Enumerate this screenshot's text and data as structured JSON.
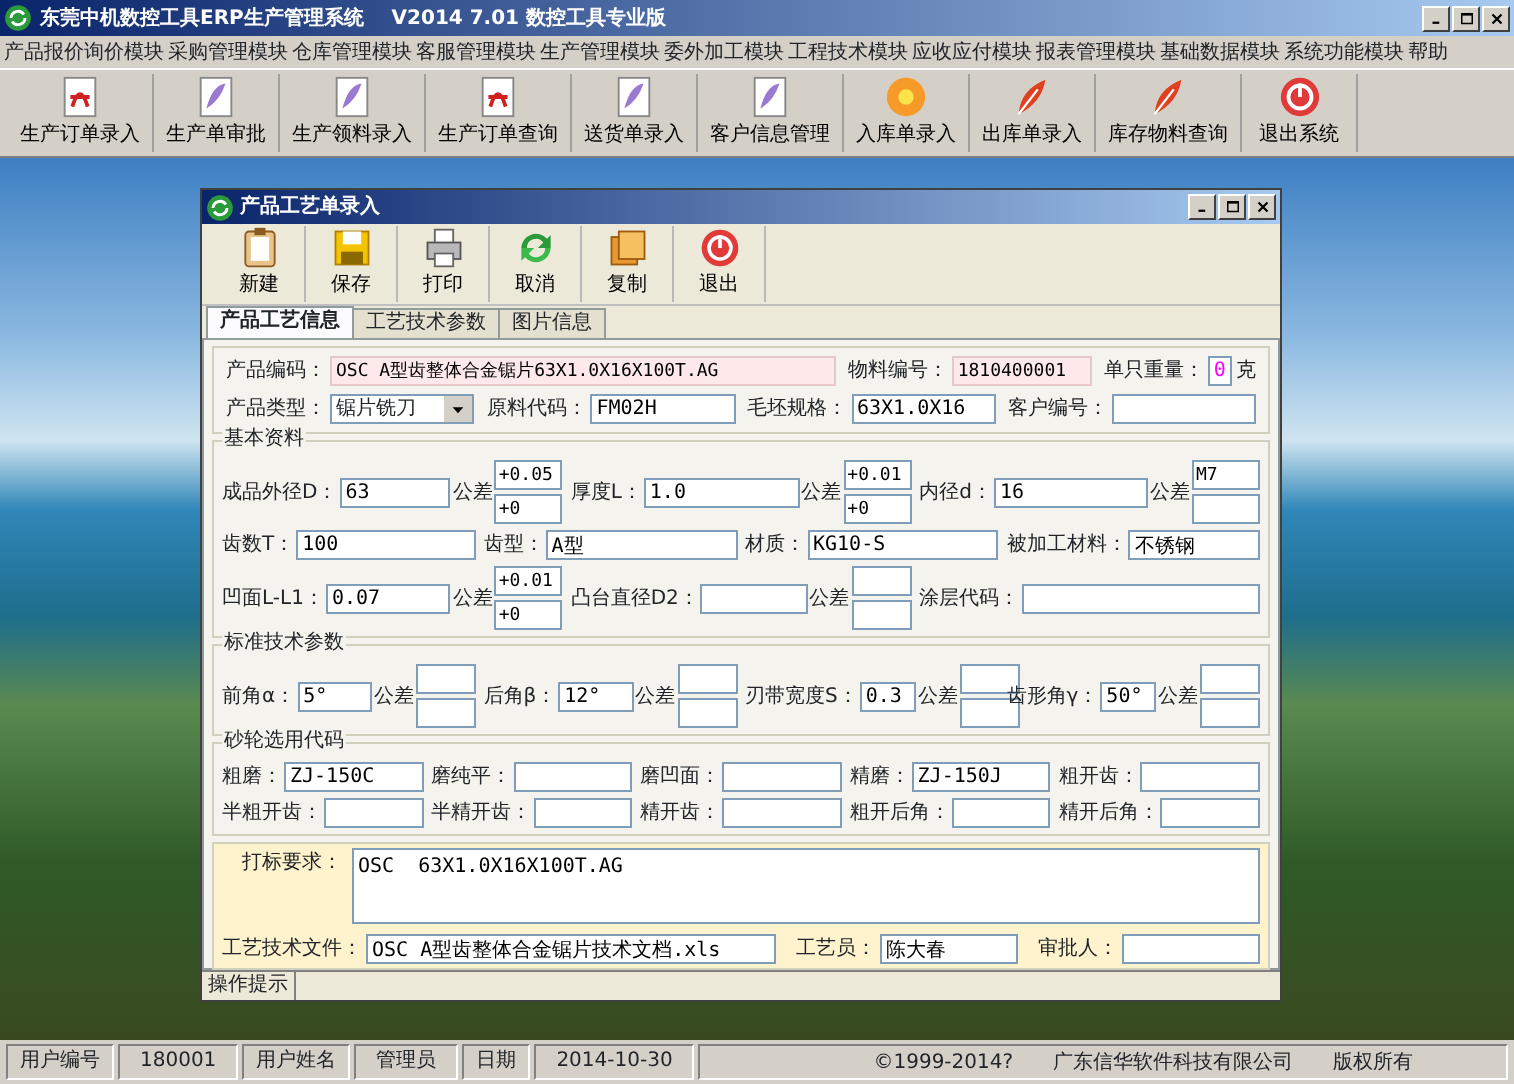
{
  "window": {
    "title": "东莞中机数控工具ERP生产管理系统    V2014 7.01 数控工具专业版"
  },
  "menu": [
    "产品报价询价模块",
    "采购管理模块",
    "仓库管理模块",
    "客服管理模块",
    "生产管理模块",
    "委外加工模块",
    "工程技术模块",
    "应收应付模块",
    "报表管理模块",
    "基础数据模块",
    "系统功能模块",
    "帮助"
  ],
  "toolbar": [
    {
      "label": "生产订单录入",
      "kind": "document"
    },
    {
      "label": "生产单审批",
      "kind": "leaf"
    },
    {
      "label": "生产领料录入",
      "kind": "leaf"
    },
    {
      "label": "生产订单查询",
      "kind": "document"
    },
    {
      "label": "送货单录入",
      "kind": "leaf"
    },
    {
      "label": "客户信息管理",
      "kind": "leaf"
    },
    {
      "label": "入库单录入",
      "kind": "flower"
    },
    {
      "label": "出库单录入",
      "kind": "feather"
    },
    {
      "label": "库存物料查询",
      "kind": "feather"
    },
    {
      "label": "退出系统",
      "kind": "exit"
    }
  ],
  "dialog": {
    "title": "产品工艺单录入",
    "toolbar": [
      {
        "label": "新建",
        "kind": "clipboard"
      },
      {
        "label": "保存",
        "kind": "floppy"
      },
      {
        "label": "打印",
        "kind": "printer"
      },
      {
        "label": "取消",
        "kind": "refresh"
      },
      {
        "label": "复制",
        "kind": "copy"
      },
      {
        "label": "退出",
        "kind": "exit"
      }
    ],
    "tabs": [
      {
        "label": "产品工艺信息",
        "selected": true
      },
      {
        "label": "工艺技术参数",
        "selected": false
      },
      {
        "label": "图片信息",
        "selected": false
      }
    ],
    "header_rows": [
      [
        {
          "label": "产品编码：",
          "value": "OSC A型齿整体合金锯片63X1.0X16X100T.AG",
          "kind": "required"
        },
        {
          "label": "物料编号：",
          "value": "1810400001",
          "kind": "required"
        },
        {
          "label": "单只重量：",
          "value": "0",
          "unit": "克",
          "kind": "number"
        }
      ],
      [
        {
          "label": "产品类型：",
          "value": "锯片铣刀",
          "kind": "select"
        },
        {
          "label": "原料代码：",
          "value": "FM02H",
          "kind": "text"
        },
        {
          "label": "毛坯规格：",
          "value": "63X1.0X16",
          "kind": "text"
        },
        {
          "label": "客户编号：",
          "kind": "text"
        }
      ]
    ],
    "groups": [
      {
        "title": "基本资料",
        "lines": [
          {
            "fields": [
              {
                "label": "成品外径D：",
                "value": "63",
                "tolerance": {
                  "label": "公差",
                  "upper": "+0.05",
                  "lower": "+0"
                }
              },
              {
                "label": "厚度L：",
                "value": "1.0",
                "tolerance": {
                  "label": "公差",
                  "upper": "+0.01",
                  "lower": "+0"
                }
              },
              {
                "label": "内径d：",
                "value": "16",
                "tolerance": {
                  "label": "公差",
                  "upper": "M7"
                }
              }
            ]
          },
          {
            "fields": [
              {
                "label": "齿数T：",
                "value": "100"
              },
              {
                "label": "齿型：",
                "value": "A型"
              },
              {
                "label": "材质：",
                "value": "KG10-S"
              },
              {
                "label": "被加工材料：",
                "value": "不锈钢"
              }
            ]
          },
          {
            "fields": [
              {
                "label": "凹面L-L1：",
                "value": "0.07",
                "tolerance": {
                  "label": "公差",
                  "upper": "+0.01",
                  "lower": "+0"
                }
              },
              {
                "label": "凸台直径D2：",
                "tolerance": {
                  "label": "公差"
                }
              },
              {
                "label": "涂层代码："
              }
            ]
          }
        ]
      },
      {
        "title": "标准技术参数",
        "lines": [
          {
            "fields": [
              {
                "label": "前角α：",
                "value": "5°",
                "tolerance": {
                  "label": "公差"
                }
              },
              {
                "label": "后角β：",
                "value": "12°",
                "tolerance": {
                  "label": "公差"
                }
              },
              {
                "label": "刃带宽度S：",
                "value": "0.3",
                "tolerance": {
                  "label": "公差"
                }
              },
              {
                "label": "齿形角γ：",
                "value": "50°",
                "tolerance": {
                  "label": "公差"
                }
              }
            ]
          }
        ]
      },
      {
        "title": "砂轮选用代码",
        "lines": [
          {
            "fields": [
              {
                "label": "粗磨：",
                "value": "ZJ-150C"
              },
              {
                "label": "磨纯平："
              },
              {
                "label": "磨凹面："
              },
              {
                "label": "精磨：",
                "value": "ZJ-150J"
              },
              {
                "label": "粗开齿："
              }
            ]
          },
          {
            "fields": [
              {
                "label": "半粗开齿："
              },
              {
                "label": "半精开齿："
              },
              {
                "label": "精开齿："
              },
              {
                "label": "粗开后角："
              },
              {
                "label": "精开后角："
              }
            ]
          }
        ]
      }
    ],
    "marking": {
      "label": "打标要求：",
      "value": "OSC  63X1.0X16X100T.AG"
    },
    "footer_fields": [
      {
        "label": "工艺技术文件：",
        "value": "OSC A型齿整体合金锯片技术文档.xls"
      },
      {
        "label": "工艺员：",
        "value": "陈大春"
      },
      {
        "label": "审批人："
      }
    ],
    "hint": "操作提示"
  },
  "status_bar": {
    "cells": [
      {
        "text": "用户编号",
        "kind": "label"
      },
      {
        "text": "180001",
        "kind": "value"
      },
      {
        "text": "用户姓名",
        "kind": "label"
      },
      {
        "text": "管理员",
        "kind": "value"
      },
      {
        "text": "日期",
        "kind": "label"
      },
      {
        "text": "2014-10-30",
        "kind": "value"
      }
    ],
    "info": [
      "©1999-2014?",
      "广东信华软件科技有限公司",
      "版权所有"
    ]
  }
}
